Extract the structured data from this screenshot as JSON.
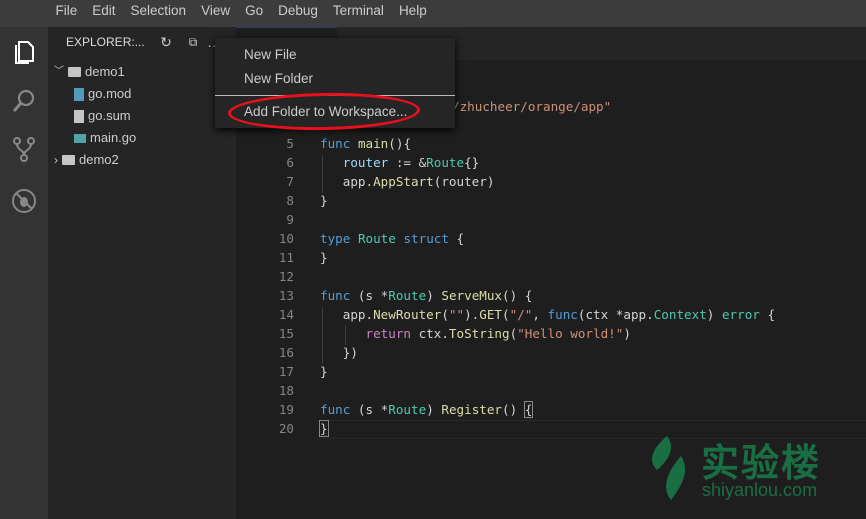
{
  "menubar": {
    "items": [
      "File",
      "Edit",
      "Selection",
      "View",
      "Go",
      "Debug",
      "Terminal",
      "Help"
    ]
  },
  "activity_bar": {
    "icons": [
      "files-icon",
      "search-icon",
      "source-control-icon",
      "debug-icon"
    ]
  },
  "sidebar": {
    "title": "EXPLORER:...",
    "actions": [
      "refresh-icon",
      "collapse-all-icon",
      "more-icon"
    ],
    "tree": [
      {
        "label": "demo1",
        "type": "folder",
        "expanded": true
      },
      {
        "label": "go.mod",
        "type": "file"
      },
      {
        "label": "go.sum",
        "type": "file"
      },
      {
        "label": "main.go",
        "type": "file"
      },
      {
        "label": "demo2",
        "type": "folder",
        "expanded": false
      }
    ]
  },
  "context_menu": {
    "items": [
      "New File",
      "New Folder",
      "Add Folder to Workspace..."
    ],
    "highlight_color": "#e8101c"
  },
  "editor": {
    "visible_fragment_line3": "/zhucheer/orange/app\"",
    "line_numbers": [
      "5",
      "6",
      "7",
      "8",
      "9",
      "10",
      "11",
      "12",
      "13",
      "14",
      "15",
      "16",
      "17",
      "18",
      "19",
      "20"
    ]
  },
  "watermark": {
    "name_cn": "实验楼",
    "url": "shiyanlou.com",
    "color": "#1a6e43"
  }
}
